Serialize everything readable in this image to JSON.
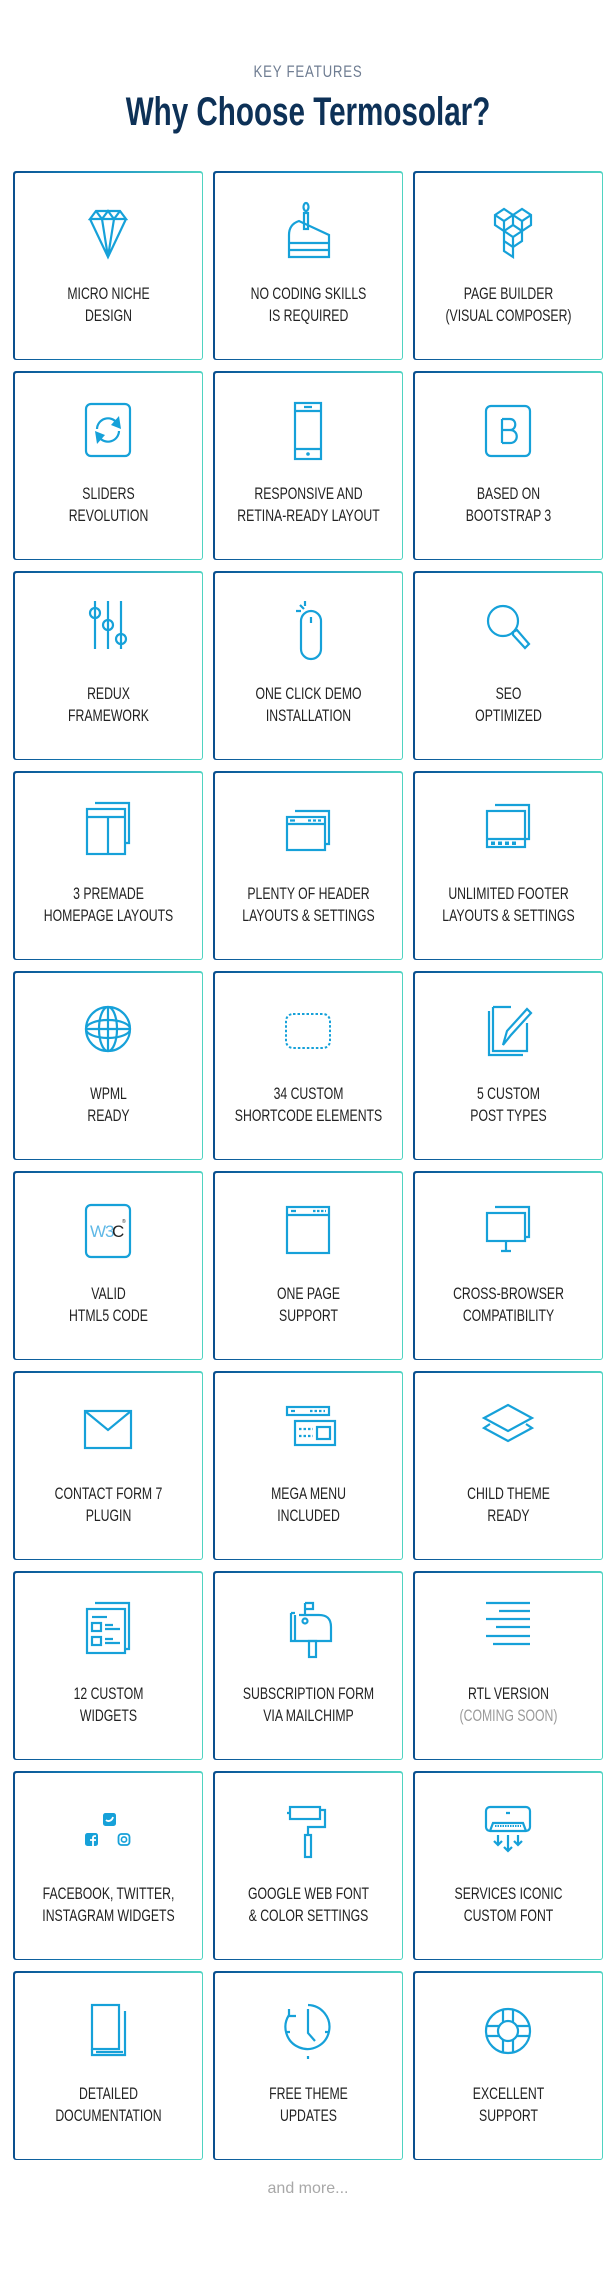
{
  "header": {
    "kicker": "KEY FEATURES",
    "title": "Why Choose Termosolar?"
  },
  "colors": {
    "title": "#0d3157",
    "kicker": "#6f7d92",
    "icon": "#16a1d9",
    "label": "#222222",
    "label_muted": "#9a9a9a",
    "border_start": "#0a4f8e",
    "border_end": "#4fd3c1"
  },
  "features": [
    {
      "icon": "diamond-icon",
      "line1": "MICRO NICHE",
      "line2": "DESIGN"
    },
    {
      "icon": "cake-slice-icon",
      "line1": "NO CODING SKILLS",
      "line2": "IS REQUIRED"
    },
    {
      "icon": "cubes-icon",
      "line1": "PAGE BUILDER",
      "line2": "(VISUAL COMPOSER)"
    },
    {
      "icon": "refresh-icon",
      "line1": "SLIDERS",
      "line2": "REVOLUTION"
    },
    {
      "icon": "smartphone-icon",
      "line1": "RESPONSIVE AND",
      "line2": "RETINA-READY LAYOUT"
    },
    {
      "icon": "bootstrap-icon",
      "line1": "BASED ON",
      "line2": "BOOTSTRAP 3"
    },
    {
      "icon": "sliders-icon",
      "line1": "REDUX",
      "line2": "FRAMEWORK"
    },
    {
      "icon": "mouse-click-icon",
      "line1": "ONE CLICK DEMO",
      "line2": "INSTALLATION"
    },
    {
      "icon": "magnifier-icon",
      "line1": "SEO",
      "line2": "OPTIMIZED"
    },
    {
      "icon": "layouts-icon",
      "line1": "3 PREMADE",
      "line2": "HOMEPAGE LAYOUTS"
    },
    {
      "icon": "header-window-icon",
      "line1": "PLENTY OF HEADER",
      "line2": "LAYOUTS & SETTINGS"
    },
    {
      "icon": "footer-window-icon",
      "line1": "UNLIMITED FOOTER",
      "line2": "LAYOUTS & SETTINGS"
    },
    {
      "icon": "globe-icon",
      "line1": "WPML",
      "line2": "READY"
    },
    {
      "icon": "dashed-box-icon",
      "line1": "34 CUSTOM",
      "line2": "SHORTCODE ELEMENTS"
    },
    {
      "icon": "edit-post-icon",
      "line1": "5 CUSTOM",
      "line2": "POST TYPES"
    },
    {
      "icon": "w3c-icon",
      "line1": "VALID",
      "line2": "HTML5 CODE",
      "w3c_text": "W3C"
    },
    {
      "icon": "browser-window-icon",
      "line1": "ONE PAGE",
      "line2": "SUPPORT"
    },
    {
      "icon": "monitors-icon",
      "line1": "CROSS-BROWSER",
      "line2": "COMPATIBILITY"
    },
    {
      "icon": "envelope-icon",
      "line1": "CONTACT FORM 7",
      "line2": "PLUGIN"
    },
    {
      "icon": "mega-menu-icon",
      "line1": "MEGA MENU",
      "line2": "INCLUDED"
    },
    {
      "icon": "layers-icon",
      "line1": "CHILD THEME",
      "line2": "READY"
    },
    {
      "icon": "widgets-icon",
      "line1": "12 CUSTOM",
      "line2": "WIDGETS"
    },
    {
      "icon": "mailbox-icon",
      "line1": "SUBSCRIPTION FORM",
      "line2": "VIA MAILCHIMP"
    },
    {
      "icon": "align-right-icon",
      "line1": "RTL VERSION",
      "line2": "(COMING SOON)",
      "muted_line2": true
    },
    {
      "icon": "social-icons",
      "line1": "FACEBOOK, TWITTER,",
      "line2": "INSTAGRAM WIDGETS"
    },
    {
      "icon": "paint-roller-icon",
      "line1": "GOOGLE WEB FONT",
      "line2": "& COLOR SETTINGS"
    },
    {
      "icon": "air-conditioner-icon",
      "line1": "SERVICES ICONIC",
      "line2": "CUSTOM FONT"
    },
    {
      "icon": "book-icon",
      "line1": "DETAILED",
      "line2": "DOCUMENTATION"
    },
    {
      "icon": "clock-update-icon",
      "line1": "FREE THEME",
      "line2": "UPDATES"
    },
    {
      "icon": "lifebuoy-icon",
      "line1": "EXCELLENT",
      "line2": "SUPPORT"
    }
  ],
  "footer": {
    "more_text": "and more..."
  }
}
